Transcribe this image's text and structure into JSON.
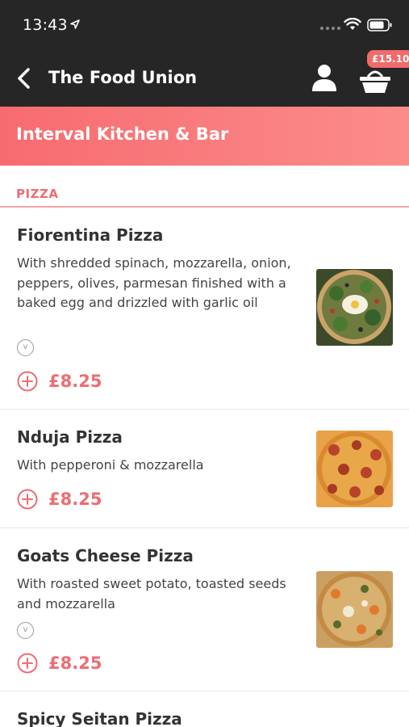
{
  "status_bar": {
    "time": "13:43"
  },
  "nav": {
    "title": "The Food Union",
    "cart_total": "£15.10"
  },
  "restaurant": {
    "name": "Interval Kitchen & Bar"
  },
  "section": {
    "title": "PIZZA"
  },
  "colors": {
    "accent": "#ee6d73",
    "header_bg": "#262626",
    "banner_start": "#f76b70",
    "banner_end": "#fb8c8a"
  },
  "items": [
    {
      "name": "Fiorentina Pizza",
      "description": "With shredded spinach, mozzarella, onion, peppers, olives, parmesan finished with a baked egg and drizzled with garlic oil",
      "veg_badge": "v",
      "price": "£8.25"
    },
    {
      "name": "Nduja Pizza",
      "description": "With pepperoni & mozzarella",
      "price": "£8.25"
    },
    {
      "name": "Goats Cheese Pizza",
      "description": "With roasted sweet potato, toasted seeds and mozzarella",
      "veg_badge": "v",
      "price": "£8.25"
    },
    {
      "name": "Spicy Seitan Pizza"
    }
  ]
}
